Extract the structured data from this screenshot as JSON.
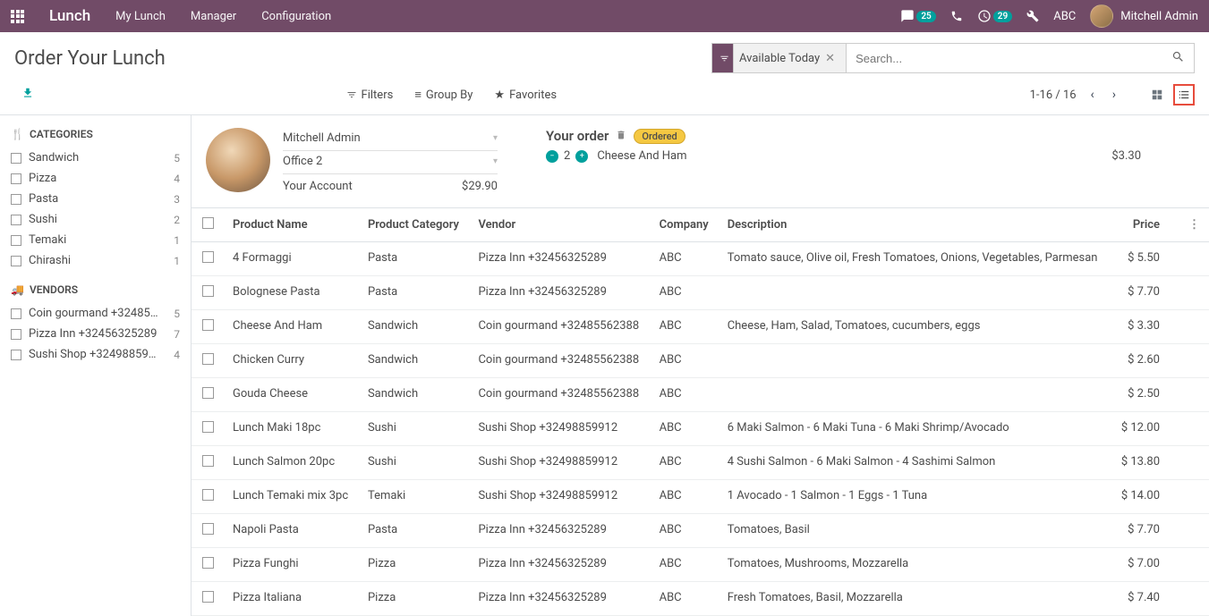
{
  "navbar": {
    "brand": "Lunch",
    "links": [
      "My Lunch",
      "Manager",
      "Configuration"
    ],
    "chat_count": "25",
    "activity_count": "29",
    "company": "ABC",
    "user": "Mitchell Admin"
  },
  "page": {
    "title": "Order Your Lunch",
    "search_facet": "Available Today",
    "search_placeholder": "Search...",
    "filters_label": "Filters",
    "groupby_label": "Group By",
    "favorites_label": "Favorites",
    "pager": "1-16 / 16"
  },
  "sidebar": {
    "categories_h": "CATEGORIES",
    "vendors_h": "VENDORS",
    "categories": [
      {
        "name": "Sandwich",
        "count": "5"
      },
      {
        "name": "Pizza",
        "count": "4"
      },
      {
        "name": "Pasta",
        "count": "3"
      },
      {
        "name": "Sushi",
        "count": "2"
      },
      {
        "name": "Temaki",
        "count": "1"
      },
      {
        "name": "Chirashi",
        "count": "1"
      }
    ],
    "vendors": [
      {
        "name": "Coin gourmand +32485...",
        "count": "5"
      },
      {
        "name": "Pizza Inn +32456325289",
        "count": "7"
      },
      {
        "name": "Sushi Shop +324988599...",
        "count": "4"
      }
    ]
  },
  "order": {
    "user_select": "Mitchell Admin",
    "location_select": "Office 2",
    "account_label": "Your Account",
    "account_balance": "$29.90",
    "heading": "Your order",
    "status": "Ordered",
    "qty": "2",
    "item": "Cheese And Ham",
    "price": "$3.30"
  },
  "table": {
    "headers": {
      "name": "Product Name",
      "cat": "Product Category",
      "vendor": "Vendor",
      "company": "Company",
      "desc": "Description",
      "price": "Price"
    },
    "rows": [
      {
        "name": "4 Formaggi",
        "cat": "Pasta",
        "vendor": "Pizza Inn +32456325289",
        "company": "ABC",
        "desc": "Tomato sauce, Olive oil, Fresh Tomatoes, Onions, Vegetables, Parmesan",
        "price": "$ 5.50"
      },
      {
        "name": "Bolognese Pasta",
        "cat": "Pasta",
        "vendor": "Pizza Inn +32456325289",
        "company": "ABC",
        "desc": "",
        "price": "$ 7.70"
      },
      {
        "name": "Cheese And Ham",
        "cat": "Sandwich",
        "vendor": "Coin gourmand +32485562388",
        "company": "ABC",
        "desc": "Cheese, Ham, Salad, Tomatoes, cucumbers, eggs",
        "price": "$ 3.30"
      },
      {
        "name": "Chicken Curry",
        "cat": "Sandwich",
        "vendor": "Coin gourmand +32485562388",
        "company": "ABC",
        "desc": "",
        "price": "$ 2.60"
      },
      {
        "name": "Gouda Cheese",
        "cat": "Sandwich",
        "vendor": "Coin gourmand +32485562388",
        "company": "ABC",
        "desc": "",
        "price": "$ 2.50"
      },
      {
        "name": "Lunch Maki 18pc",
        "cat": "Sushi",
        "vendor": "Sushi Shop +32498859912",
        "company": "ABC",
        "desc": "6 Maki Salmon - 6 Maki Tuna - 6 Maki Shrimp/Avocado",
        "price": "$ 12.00"
      },
      {
        "name": "Lunch Salmon 20pc",
        "cat": "Sushi",
        "vendor": "Sushi Shop +32498859912",
        "company": "ABC",
        "desc": "4 Sushi Salmon - 6 Maki Salmon - 4 Sashimi Salmon",
        "price": "$ 13.80"
      },
      {
        "name": "Lunch Temaki mix 3pc",
        "cat": "Temaki",
        "vendor": "Sushi Shop +32498859912",
        "company": "ABC",
        "desc": "1 Avocado - 1 Salmon - 1 Eggs - 1 Tuna",
        "price": "$ 14.00"
      },
      {
        "name": "Napoli Pasta",
        "cat": "Pasta",
        "vendor": "Pizza Inn +32456325289",
        "company": "ABC",
        "desc": "Tomatoes, Basil",
        "price": "$ 7.70"
      },
      {
        "name": "Pizza Funghi",
        "cat": "Pizza",
        "vendor": "Pizza Inn +32456325289",
        "company": "ABC",
        "desc": "Tomatoes, Mushrooms, Mozzarella",
        "price": "$ 7.00"
      },
      {
        "name": "Pizza Italiana",
        "cat": "Pizza",
        "vendor": "Pizza Inn +32456325289",
        "company": "ABC",
        "desc": "Fresh Tomatoes, Basil, Mozzarella",
        "price": "$ 7.40"
      }
    ]
  }
}
